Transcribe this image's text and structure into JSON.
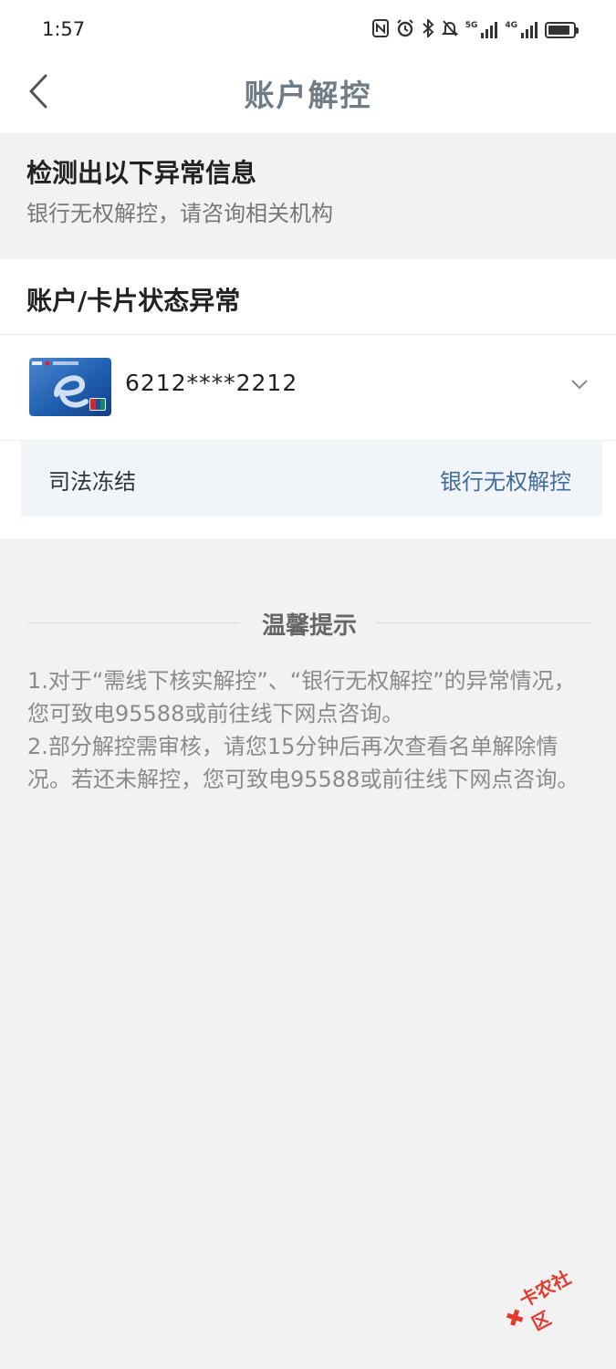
{
  "status_bar": {
    "time": "1:57",
    "icons": [
      "nfc-icon",
      "alarm-icon",
      "bluetooth-icon",
      "mute-icon",
      "signal-5g-icon",
      "signal-4g-icon",
      "battery-icon"
    ],
    "sig1_tag": "5G",
    "sig2_tag": "4G"
  },
  "navbar": {
    "title": "账户解控"
  },
  "anomaly": {
    "heading": "检测出以下异常信息",
    "subtext": "银行无权解控，请咨询相关机构"
  },
  "status_section": {
    "title": "账户/卡片状态异常",
    "card_number": "6212****2212",
    "freeze_label": "司法冻结",
    "freeze_value": "银行无权解控"
  },
  "tips": {
    "title": "温馨提示",
    "line1": "1.对于“需线下核实解控”、“银行无权解控”的异常情况，您可致电95588或前往线下网点咨询。",
    "line2": "2.部分解控需审核，请您15分钟后再次查看名单解除情况。若还未解控，您可致电95588或前往线下网点咨询。"
  },
  "watermark": {
    "text": "卡农社区"
  },
  "colors": {
    "accent": "#3f6c9a",
    "title": "#6f7c86",
    "background": "#f2f2f2"
  }
}
